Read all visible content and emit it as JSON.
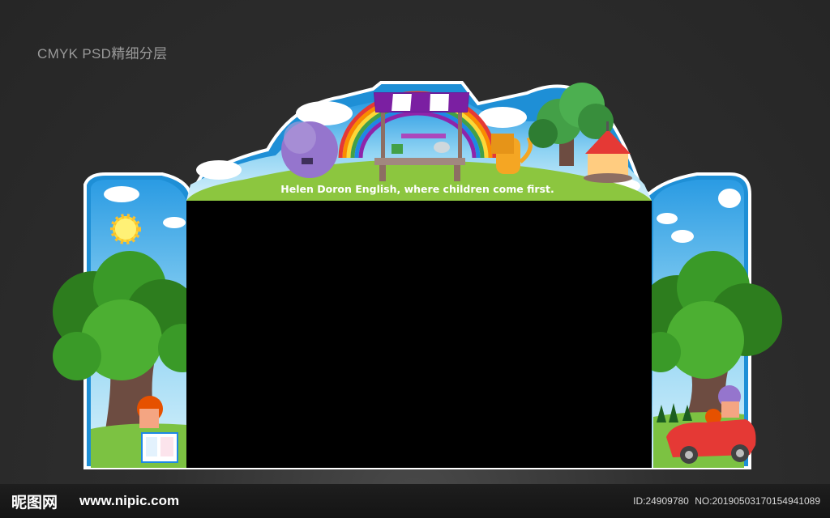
{
  "corner_label": "CMYK PSD精细分层",
  "slogan": "Helen Doron English, where children come first.",
  "footer": {
    "logo_text": "昵图网",
    "logo_url": "www.nipic.com",
    "id_text": "ID:24909780",
    "no_text": "NO:20190503170154941089"
  },
  "colors": {
    "sky": "#8fd3f3",
    "grass": "#8cc63f",
    "border": "#1e8fd6",
    "screen": "#000000",
    "tree_dark": "#2d7d1e",
    "tree_light": "#4caf32"
  }
}
